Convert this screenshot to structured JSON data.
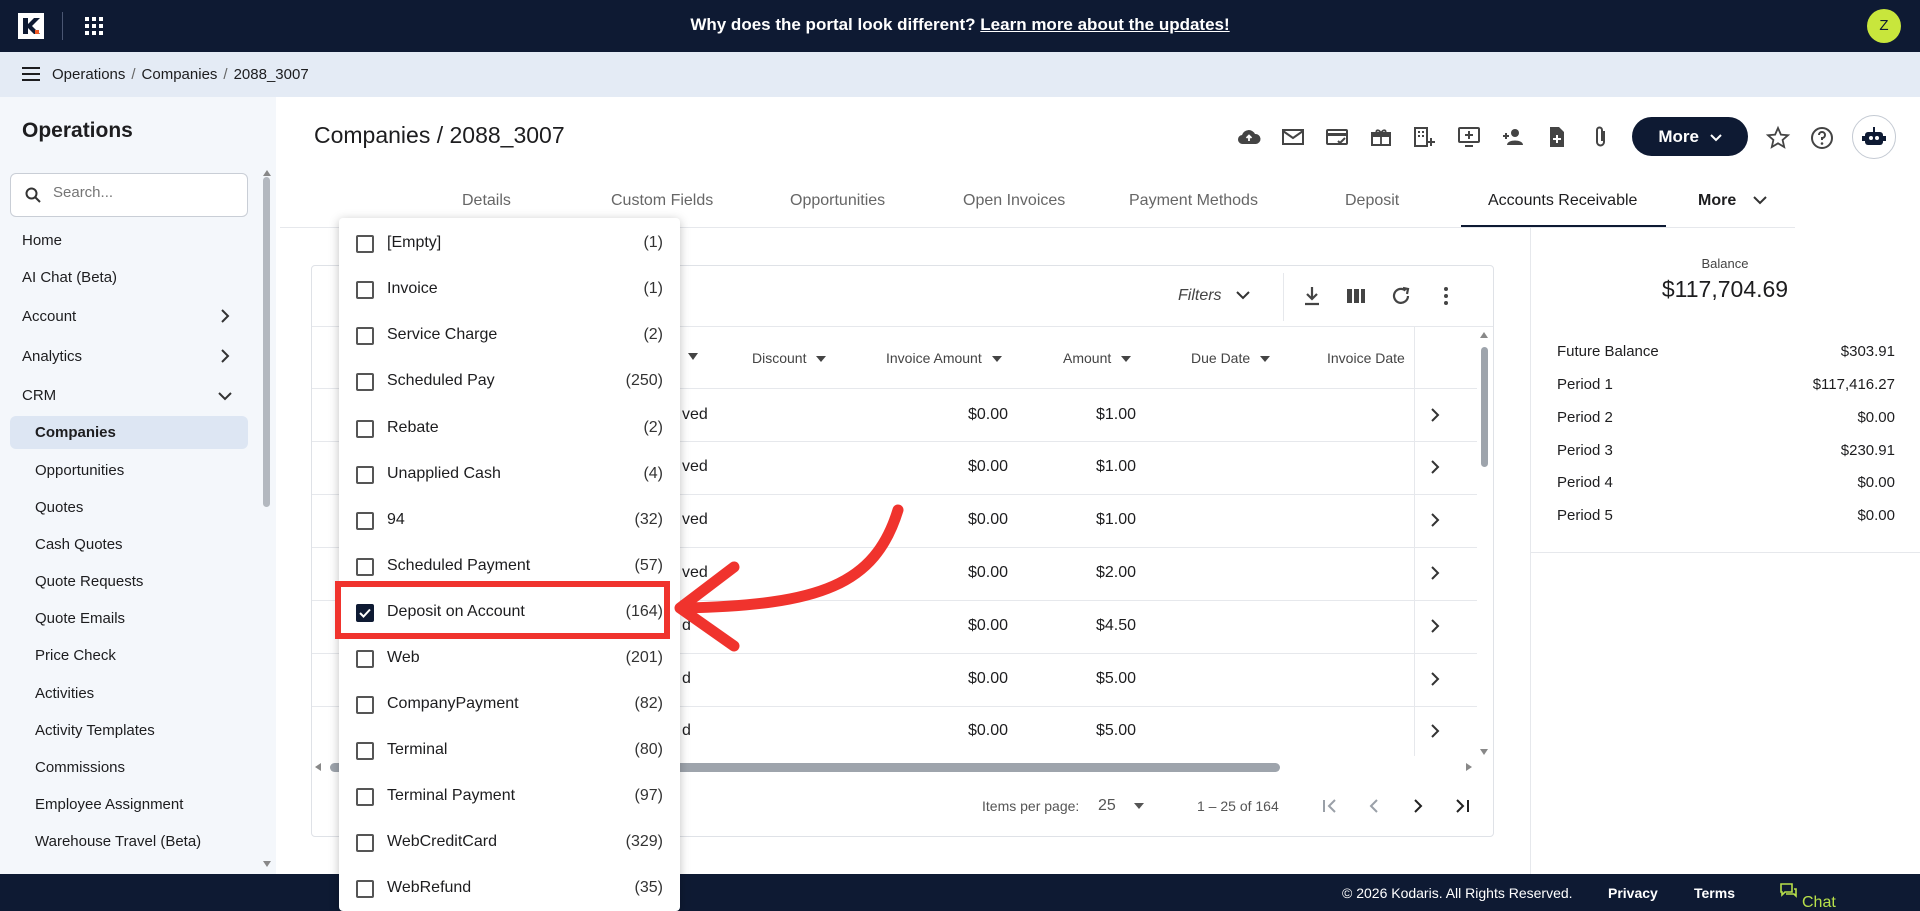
{
  "topbar": {
    "banner_text": "Why does the portal look different?",
    "banner_link": "Learn more about the updates!",
    "avatar_initial": "Z"
  },
  "breadcrumb": {
    "items": [
      "Operations",
      "Companies",
      "2088_3007"
    ]
  },
  "sidebar": {
    "title": "Operations",
    "search_placeholder": "Search...",
    "items": [
      {
        "label": "Home"
      },
      {
        "label": "AI Chat (Beta)"
      },
      {
        "label": "Account"
      },
      {
        "label": "Analytics"
      },
      {
        "label": "CRM"
      }
    ],
    "sub_items": [
      {
        "label": "Companies"
      },
      {
        "label": "Opportunities"
      },
      {
        "label": "Quotes"
      },
      {
        "label": "Cash Quotes"
      },
      {
        "label": "Quote Requests"
      },
      {
        "label": "Quote Emails"
      },
      {
        "label": "Price Check"
      },
      {
        "label": "Activities"
      },
      {
        "label": "Activity Templates"
      },
      {
        "label": "Commissions"
      },
      {
        "label": "Employee Assignment"
      },
      {
        "label": "Warehouse Travel (Beta)"
      }
    ]
  },
  "header": {
    "title": "Companies / 2088_3007",
    "more_label": "More"
  },
  "tabs": [
    {
      "label": "Details"
    },
    {
      "label": "Custom Fields"
    },
    {
      "label": "Opportunities"
    },
    {
      "label": "Open Invoices"
    },
    {
      "label": "Payment Methods"
    },
    {
      "label": "Deposit"
    },
    {
      "label": "Accounts Receivable"
    },
    {
      "label": "More"
    }
  ],
  "table": {
    "filters_label": "Filters",
    "columns": [
      "Discount",
      "Invoice Amount",
      "Amount",
      "Due Date",
      "Invoice Date"
    ],
    "rows": [
      {
        "status_fragment": "ved",
        "discount": "",
        "invoice_amount": "$0.00",
        "amount": "$1.00"
      },
      {
        "status_fragment": "ved",
        "discount": "",
        "invoice_amount": "$0.00",
        "amount": "$1.00"
      },
      {
        "status_fragment": "ved",
        "discount": "",
        "invoice_amount": "$0.00",
        "amount": "$1.00"
      },
      {
        "status_fragment": "ved",
        "discount": "",
        "invoice_amount": "$0.00",
        "amount": "$2.00"
      },
      {
        "status_fragment": "d",
        "discount": "",
        "invoice_amount": "$0.00",
        "amount": "$4.50"
      },
      {
        "status_fragment": "d",
        "discount": "",
        "invoice_amount": "$0.00",
        "amount": "$5.00"
      },
      {
        "status_fragment": "d",
        "discount": "",
        "invoice_amount": "$0.00",
        "amount": "$5.00"
      }
    ],
    "pager": {
      "items_per_page_label": "Items per page:",
      "items_per_page": "25",
      "range": "1 – 25 of 164"
    }
  },
  "balance": {
    "caption": "Balance",
    "total": "$117,704.69",
    "lines": [
      {
        "label": "Future Balance",
        "value": "$303.91"
      },
      {
        "label": "Period 1",
        "value": "$117,416.27"
      },
      {
        "label": "Period 2",
        "value": "$0.00"
      },
      {
        "label": "Period 3",
        "value": "$230.91"
      },
      {
        "label": "Period 4",
        "value": "$0.00"
      },
      {
        "label": "Period 5",
        "value": "$0.00"
      }
    ]
  },
  "dropdown": {
    "options": [
      {
        "label": "[Empty]",
        "count": "(1)",
        "checked": false
      },
      {
        "label": "Invoice",
        "count": "(1)",
        "checked": false
      },
      {
        "label": "Service Charge",
        "count": "(2)",
        "checked": false
      },
      {
        "label": "Scheduled Pay",
        "count": "(250)",
        "checked": false
      },
      {
        "label": "Rebate",
        "count": "(2)",
        "checked": false
      },
      {
        "label": "Unapplied Cash",
        "count": "(4)",
        "checked": false
      },
      {
        "label": "94",
        "count": "(32)",
        "checked": false
      },
      {
        "label": "Scheduled Payment",
        "count": "(57)",
        "checked": false
      },
      {
        "label": "Deposit on Account",
        "count": "(164)",
        "checked": true
      },
      {
        "label": "Web",
        "count": "(201)",
        "checked": false
      },
      {
        "label": "CompanyPayment",
        "count": "(82)",
        "checked": false
      },
      {
        "label": "Terminal",
        "count": "(80)",
        "checked": false
      },
      {
        "label": "Terminal Payment",
        "count": "(97)",
        "checked": false
      },
      {
        "label": "WebCreditCard",
        "count": "(329)",
        "checked": false
      },
      {
        "label": "WebRefund",
        "count": "(35)",
        "checked": false
      }
    ]
  },
  "footer": {
    "copyright": "© 2026 Kodaris. All Rights Reserved.",
    "privacy": "Privacy",
    "terms": "Terms",
    "chat": "Chat with us"
  },
  "colors": {
    "navy": "#0e1a33",
    "accent_green": "#c8e63c",
    "annotation_red": "#f0332d"
  }
}
